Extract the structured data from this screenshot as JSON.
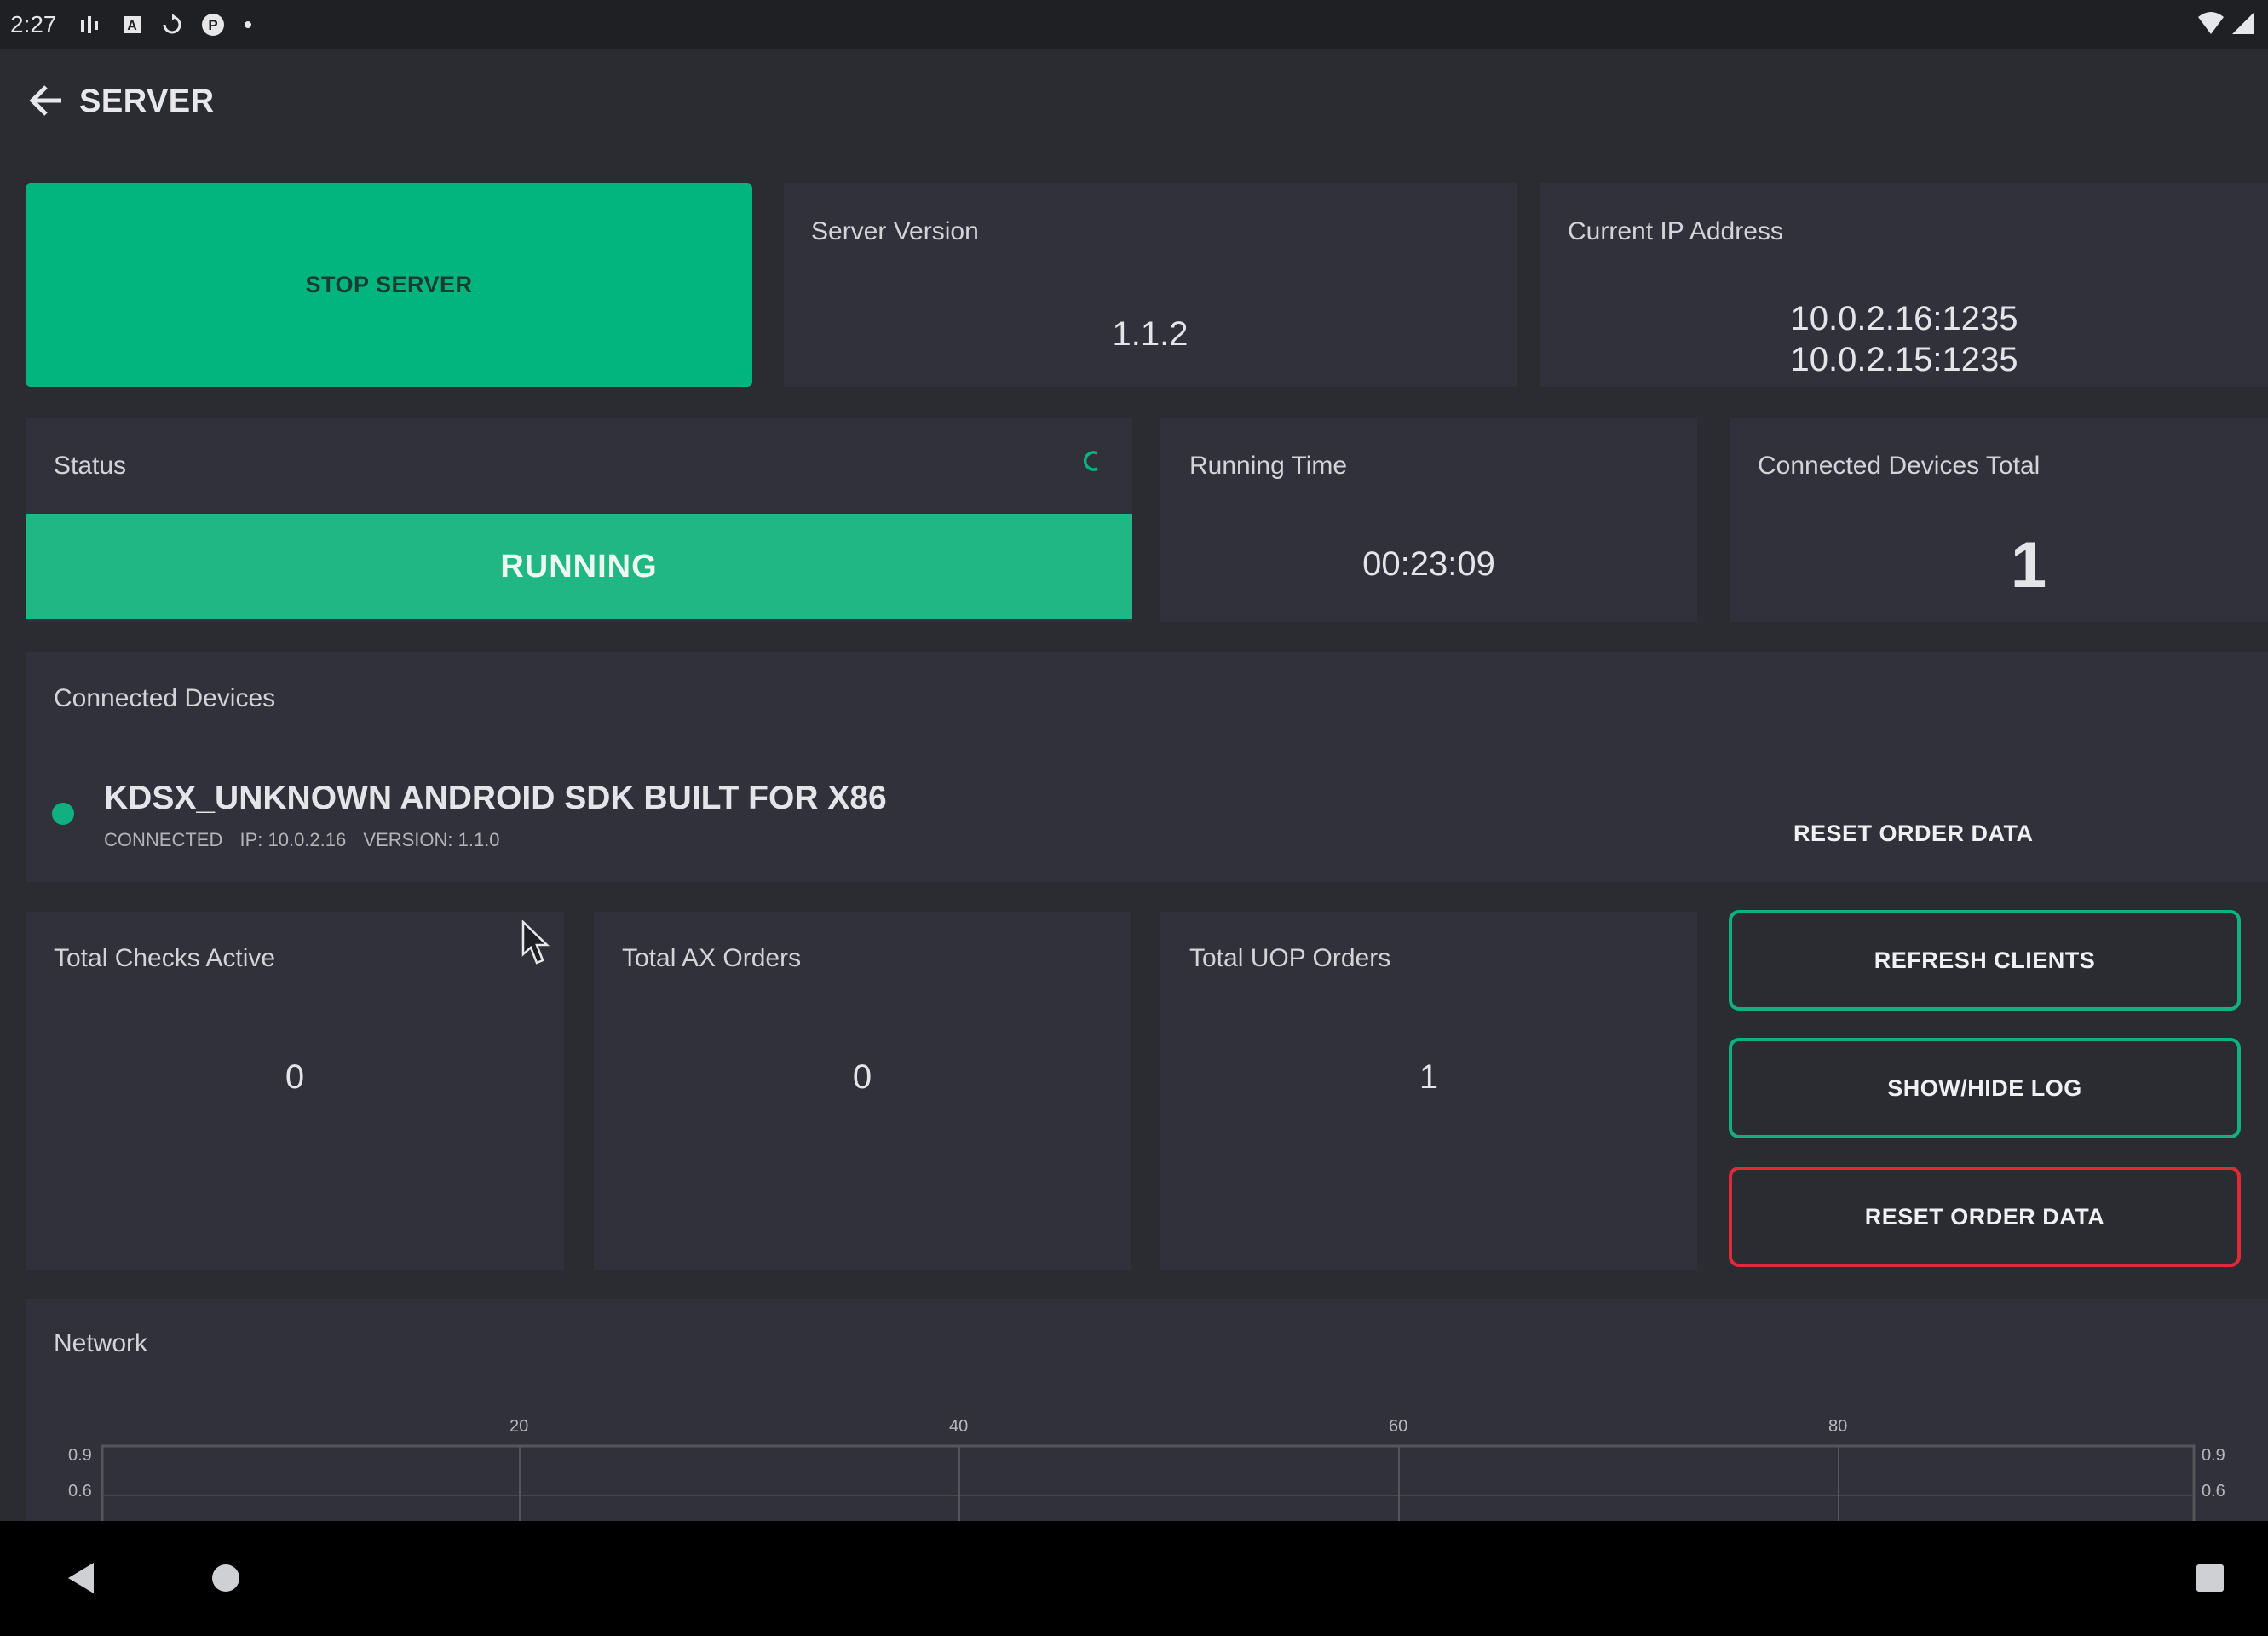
{
  "status_bar": {
    "time": "2:27",
    "icons": [
      "signal-bars-icon",
      "text-a-icon",
      "sync-icon",
      "app-p-icon",
      "dot-icon"
    ],
    "right_icons": [
      "wifi-icon",
      "cellular-icon"
    ]
  },
  "header": {
    "title": "SERVER",
    "back_icon": "arrow-left-icon"
  },
  "server_control": {
    "stop_label": "STOP SERVER"
  },
  "server_version": {
    "label": "Server Version",
    "value": "1.1.2"
  },
  "ip_address": {
    "label": "Current IP Address",
    "values": [
      "10.0.2.16:1235",
      "10.0.2.15:1235"
    ]
  },
  "status": {
    "label": "Status",
    "value": "RUNNING",
    "indicator_icon": "spinner-icon"
  },
  "running_time": {
    "label": "Running Time",
    "value": "00:23:09"
  },
  "connected_total": {
    "label": "Connected Devices Total",
    "value": "1"
  },
  "connected_devices": {
    "label": "Connected Devices",
    "devices": [
      {
        "name": "KDSX_UNKNOWN ANDROID SDK BUILT FOR X86",
        "status": "CONNECTED",
        "ip": "IP: 10.0.2.16",
        "version": "VERSION: 1.1.0",
        "status_color": "#10b081"
      }
    ],
    "reset_label": "RESET ORDER DATA"
  },
  "stats": [
    {
      "label": "Total Checks Active",
      "value": "0"
    },
    {
      "label": "Total AX Orders",
      "value": "0"
    },
    {
      "label": "Total UOP Orders",
      "value": "1"
    }
  ],
  "actions": {
    "refresh": "REFRESH CLIENTS",
    "log": "SHOW/HIDE LOG",
    "reset": "RESET ORDER DATA"
  },
  "network": {
    "label": "Network",
    "x_ticks": [
      "20",
      "40",
      "60",
      "80"
    ],
    "y_ticks_left": [
      "0.9",
      "0.6"
    ],
    "y_ticks_right": [
      "0.9",
      "0.6"
    ]
  },
  "nav_bar": {
    "icons": [
      "back-triangle-icon",
      "home-circle-icon",
      "recents-square-icon"
    ]
  },
  "colors": {
    "accent": "#02b57e",
    "running": "#20b784",
    "danger": "#e02a37",
    "background": "#2b2c32",
    "card": "#30313a"
  }
}
